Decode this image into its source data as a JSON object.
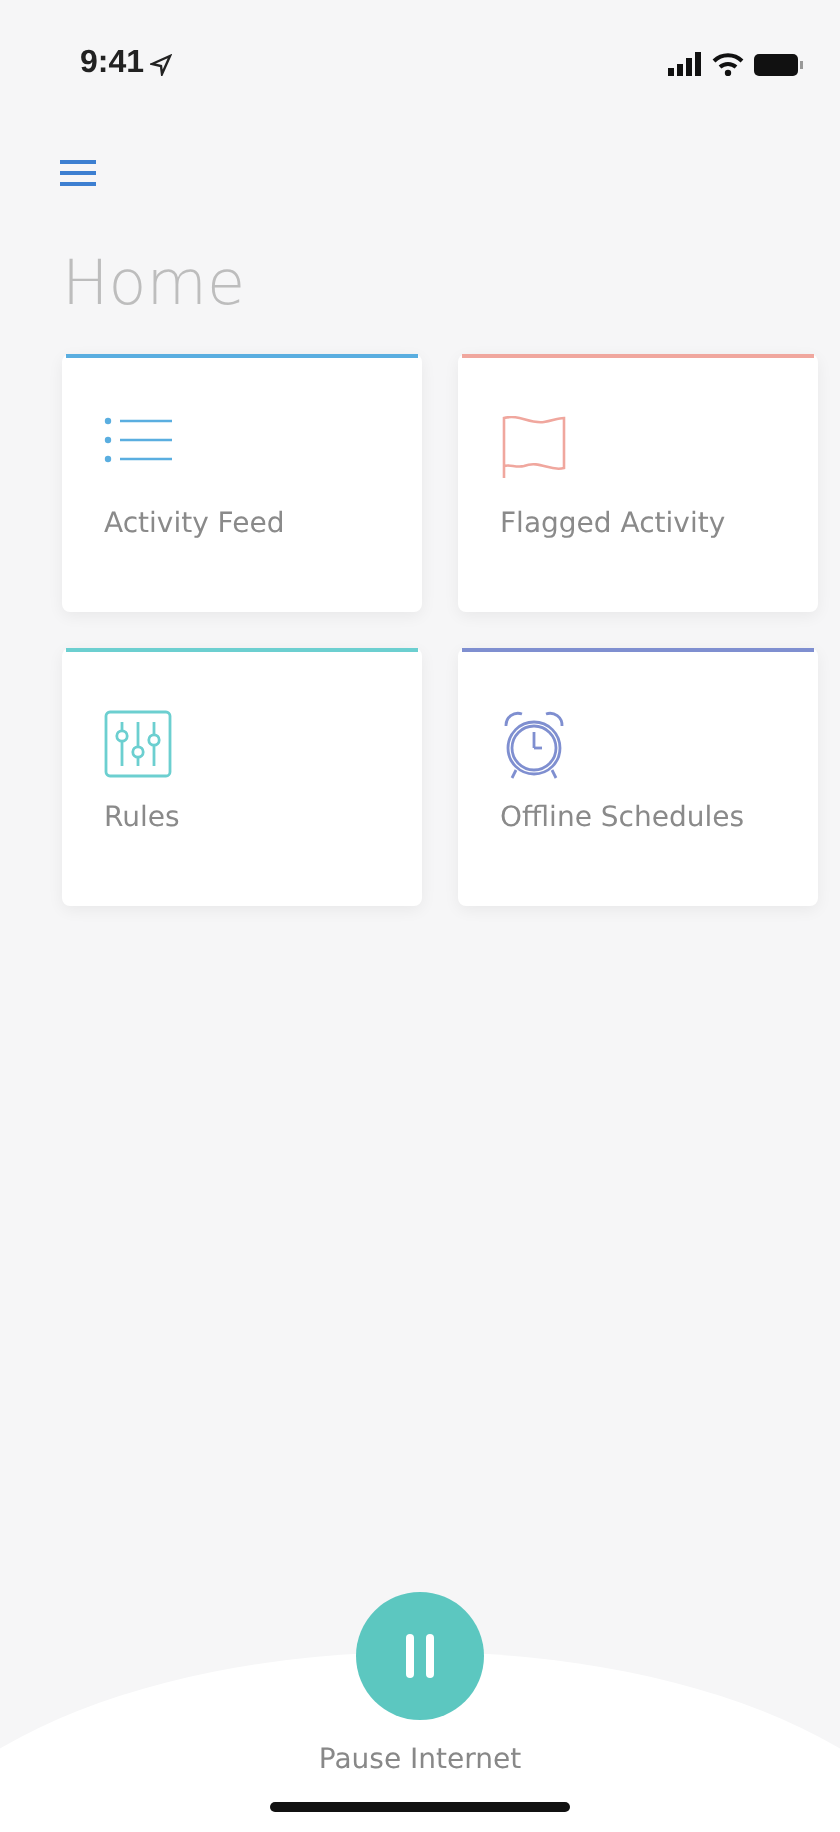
{
  "status_bar": {
    "time": "9:41"
  },
  "title": "Home",
  "tiles": [
    {
      "label": "Activity Feed",
      "kind": "list",
      "color": "#5aaee0"
    },
    {
      "label": "Flagged Activity",
      "kind": "flag",
      "color": "#f0a79e"
    },
    {
      "label": "Rules",
      "kind": "sliders",
      "color": "#6ccfd0"
    },
    {
      "label": "Offline Schedules",
      "kind": "alarm",
      "color": "#7f8fd0"
    }
  ],
  "bottom_bar": {
    "label": "Pause Internet"
  }
}
